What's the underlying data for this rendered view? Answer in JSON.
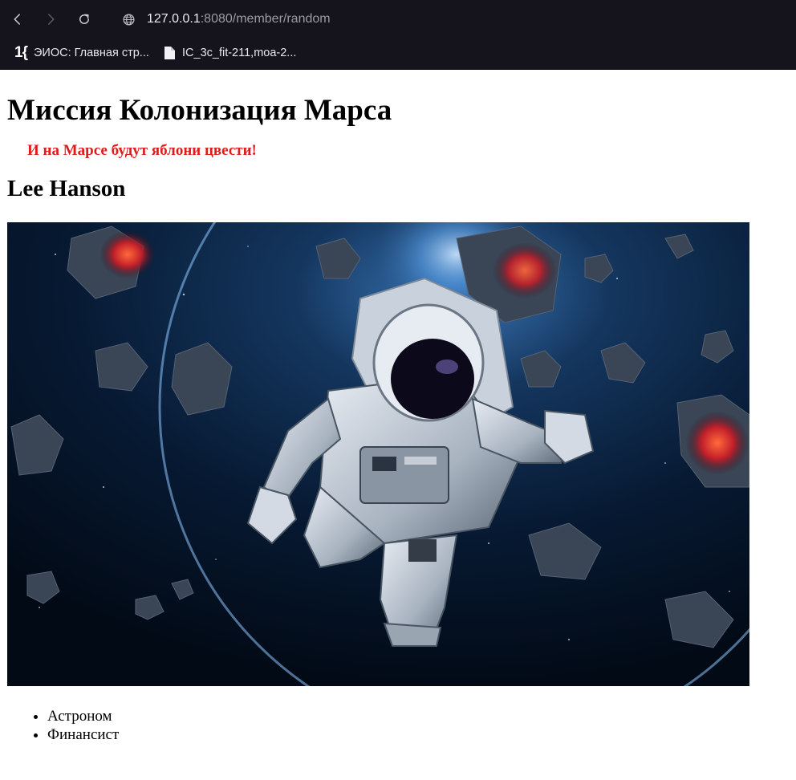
{
  "browser": {
    "url_host": "127.0.0.1",
    "url_path": ":8080/member/random",
    "bookmarks": [
      {
        "label": "ЭИОС: Главная стр...",
        "icon": "1c-logo-icon",
        "logo_text": "1{"
      },
      {
        "label": "IC_3c_fit-211,moa-2...",
        "icon": "document-icon"
      }
    ]
  },
  "page": {
    "title": "Миссия Колонизация Марса",
    "motto": "И на Марсе будут яблони цвести!",
    "member_name": "Lee Hanson",
    "photo_description": "astronaut-in-space-with-asteroids",
    "professions": [
      "Астроном",
      "Финансист"
    ]
  },
  "colors": {
    "chrome_bg": "#15131b",
    "motto_red": "#e01b1b",
    "page_bg": "#ffffff"
  }
}
